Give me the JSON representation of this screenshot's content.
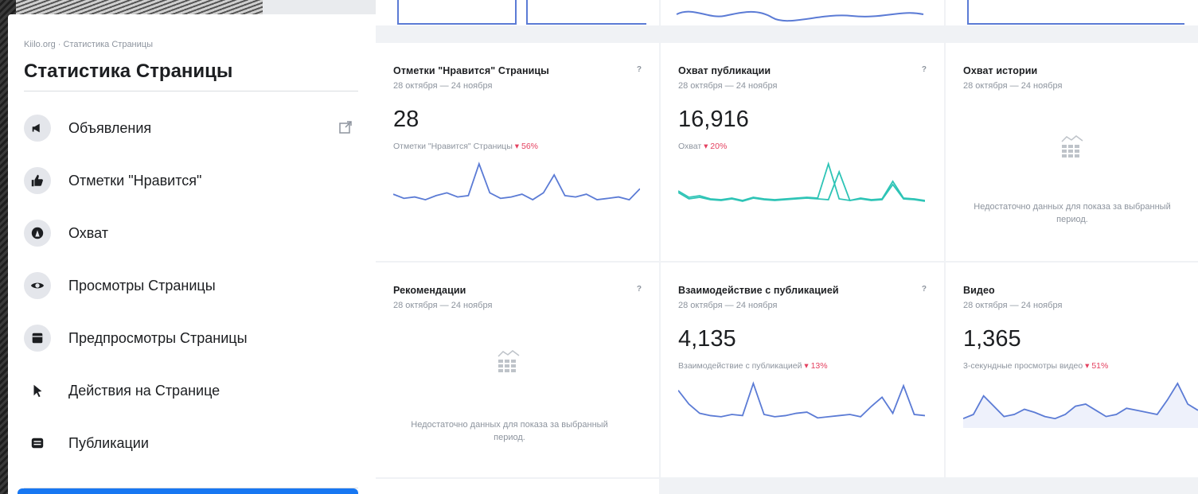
{
  "sidebar": {
    "breadcrumb": "Kiilo.org · Статистика Страницы",
    "title": "Статистика Страницы",
    "items": [
      {
        "label": "Объявления",
        "icon": "megaphone-icon"
      },
      {
        "label": "Отметки \"Нравится\"",
        "icon": "thumbs-up-icon"
      },
      {
        "label": "Охват",
        "icon": "reach-icon"
      },
      {
        "label": "Просмотры Страницы",
        "icon": "eye-icon"
      },
      {
        "label": "Предпросмотры Страницы",
        "icon": "preview-icon"
      },
      {
        "label": "Действия на Странице",
        "icon": "cursor-icon"
      },
      {
        "label": "Публикации",
        "icon": "posts-icon"
      }
    ]
  },
  "cards": {
    "likes": {
      "title": "Отметки \"Нравится\" Страницы",
      "date": "28 октября — 24 ноября",
      "value": "28",
      "sub": "Отметки \"Нравится\" Страницы",
      "change": "▾ 56%"
    },
    "post_reach": {
      "title": "Охват публикации",
      "date": "28 октября — 24 ноября",
      "value": "16,916",
      "sub": "Охват",
      "change": "▾ 20%"
    },
    "story_reach": {
      "title": "Охват истории",
      "date": "28 октября — 24 ноября",
      "empty": "Недостаточно данных для показа за выбранный период."
    },
    "recommendations": {
      "title": "Рекомендации",
      "date": "28 октября — 24 ноября",
      "empty": "Недостаточно данных для показа за выбранный период."
    },
    "engagement": {
      "title": "Взаимодействие с публикацией",
      "date": "28 октября — 24 ноября",
      "value": "4,135",
      "sub": "Взаимодействие с публикацией",
      "change": "▾ 13%"
    },
    "video": {
      "title": "Видео",
      "date": "28 октября — 24 ноября",
      "value": "1,365",
      "sub": "3-секундные просмотры видео",
      "change": "▾ 51%"
    }
  },
  "info_glyph": "?",
  "colors": {
    "accent_blue": "#1877f2",
    "spark_blue": "#5b7bd5",
    "spark_teal": "#2ec4b6",
    "negative": "#e4405f"
  },
  "chart_data": [
    {
      "type": "line",
      "series": [
        {
          "values": [
            8,
            5,
            6,
            4,
            7,
            9,
            6,
            7,
            30,
            9,
            5,
            6,
            8,
            4,
            9,
            22,
            7,
            6,
            8,
            4,
            5,
            6,
            4,
            12
          ]
        }
      ]
    },
    {
      "type": "line",
      "series": [
        {
          "values": [
            18,
            10,
            12,
            8,
            7,
            9,
            6,
            10,
            8,
            7,
            8,
            9,
            10,
            9,
            52,
            8,
            6,
            9,
            7,
            8,
            30,
            9,
            8,
            6
          ]
        },
        {
          "values": [
            16,
            8,
            10,
            7,
            6,
            8,
            5,
            9,
            7,
            6,
            7,
            8,
            9,
            8,
            7,
            42,
            6,
            8,
            6,
            7,
            26,
            8,
            7,
            5
          ]
        }
      ]
    },
    {
      "type": "line",
      "series": [
        {
          "values": [
            30,
            18,
            10,
            8,
            7,
            9,
            8,
            36,
            9,
            7,
            8,
            10,
            11,
            6,
            7,
            8,
            9,
            7,
            16,
            24,
            10,
            34,
            9,
            8
          ]
        }
      ]
    },
    {
      "type": "line",
      "series": [
        {
          "values": [
            6,
            10,
            28,
            18,
            8,
            10,
            15,
            12,
            8,
            6,
            10,
            18,
            20,
            14,
            8,
            10,
            16,
            14,
            12,
            10,
            24,
            40,
            20,
            14
          ]
        }
      ]
    }
  ]
}
